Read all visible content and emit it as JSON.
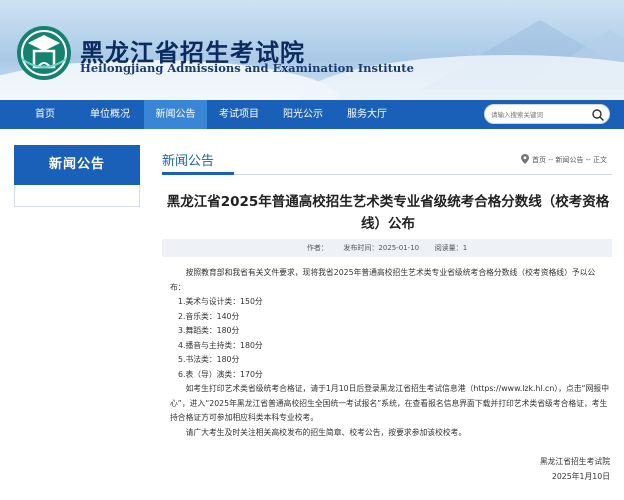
{
  "header": {
    "title": "黑龙江省招生考试院",
    "subtitle": "Heilongjiang Admissions and Examination Institute"
  },
  "nav": {
    "items": [
      {
        "label": "首页",
        "active": false
      },
      {
        "label": "单位概况",
        "active": false
      },
      {
        "label": "新闻公告",
        "active": true
      },
      {
        "label": "考试项目",
        "active": false
      },
      {
        "label": "阳光公示",
        "active": false
      },
      {
        "label": "服务大厅",
        "active": false
      }
    ],
    "search_placeholder": "请输入搜索关键词"
  },
  "sidebar": {
    "title": "新闻公告"
  },
  "content": {
    "section_title": "新闻公告",
    "breadcrumb": "首页 -- 新闻公告 -- 正文",
    "article_title": "黑龙江省2025年普通高校招生艺术类专业省级统考合格分数线（校考资格线）公布",
    "meta": {
      "author_label": "作者：",
      "author": "",
      "date_label": "发布时间：",
      "date": "2025-01-10",
      "views_label": "阅读量：",
      "views": "1"
    },
    "intro": "按照教育部和我省有关文件要求，现将我省2025年普通高校招生艺术类专业省级统考合格分数线（校考资格线）予以公布：",
    "scores": [
      "1.美术与设计类：150分",
      "2.音乐类：140分",
      "3.舞蹈类：180分",
      "4.播音与主持类：180分",
      "5.书法类：180分",
      "6.表（导）演类：170分"
    ],
    "para2": "如考生打印艺术类省级统考合格证，请于1月10日后登录黑龙江省招生考试信息港（https://www.lzk.hl.cn），点击“网报中心”，进入“2025年黑龙江省普通高校招生全国统一考试报名”系统，在查看报名信息界面下载并打印艺术类省级考合格证，考生持合格证方可参加相应科类本科专业校考。",
    "para3": "请广大考生及时关注相关高校发布的招生简章、校考公告，按要求参加该校校考。",
    "signature": "黑龙江省招生考试院",
    "sign_date": "2025年1月10日"
  },
  "colors": {
    "nav_bg": "#1a60b8",
    "nav_active": "#3a86d6",
    "title_blue": "#0b2b5e"
  }
}
